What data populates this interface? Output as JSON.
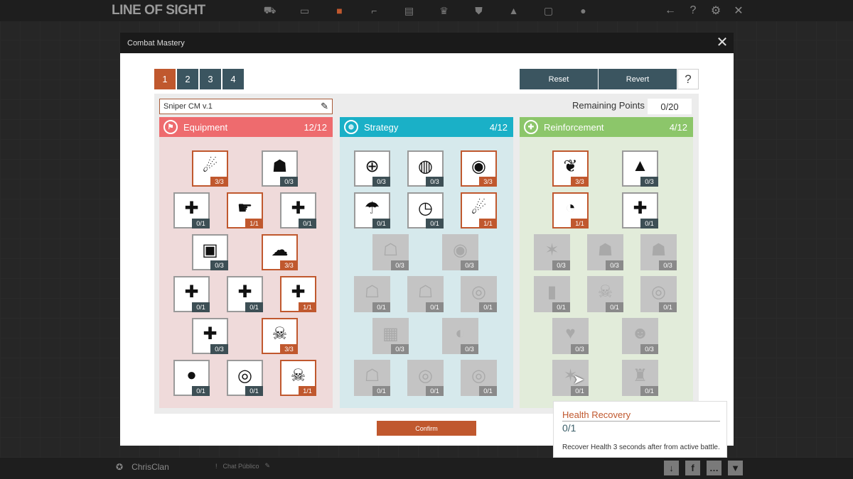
{
  "app": {
    "logo": "LINE OF SIGHT"
  },
  "topnav": [
    "cart-icon",
    "inventory-icon",
    "mastery-icon",
    "weapon-icon",
    "gear-icon",
    "trophy-icon",
    "clan-icon",
    "camp-icon",
    "box-icon",
    "hint-icon"
  ],
  "top_right": [
    "back-icon",
    "help-icon",
    "settings-icon",
    "close-icon"
  ],
  "bottom": {
    "clan_name": "ChrisClan",
    "chat_label": "Chat Público"
  },
  "modal": {
    "title": "Combat Mastery",
    "pages": [
      "1",
      "2",
      "3",
      "4"
    ],
    "active_page": "1",
    "reset_label": "Reset",
    "revert_label": "Revert",
    "help_label": "?",
    "preset_name": "Sniper CM v.1",
    "remaining_label": "Remaining Points",
    "remaining_value": "0/20",
    "confirm_label": "Confirm",
    "colors": {
      "accent": "#c0582e",
      "button": "#3b5560",
      "equipment": "#e8646a",
      "strategy": "#1ab0c7",
      "reinforcement": "#8cc66a"
    }
  },
  "columns": [
    {
      "id": "equipment",
      "name": "Equipment",
      "count": "12/12",
      "head_color": "#ee6b6e",
      "body_color": "#efdada",
      "tiles": [
        {
          "icon": "sniper-aim-icon",
          "glyph": "☄",
          "value": "3/3",
          "state": "active"
        },
        {
          "icon": "helmet-icon",
          "glyph": "☗",
          "value": "0/3",
          "state": "normal"
        },
        {
          "icon": "medkit-cross-icon",
          "glyph": "✚",
          "value": "0/1",
          "state": "normal"
        },
        {
          "icon": "hand-grenade-icon",
          "glyph": "☛",
          "value": "1/1",
          "state": "active"
        },
        {
          "icon": "plus-ammo-icon",
          "glyph": "✚",
          "value": "0/1",
          "state": "normal"
        },
        {
          "icon": "armor-vest-icon",
          "glyph": "▣",
          "value": "0/3",
          "state": "normal"
        },
        {
          "icon": "explosion-icon",
          "glyph": "☁",
          "value": "3/3",
          "state": "active"
        },
        {
          "icon": "plus-magazine-icon",
          "glyph": "✚",
          "value": "0/1",
          "state": "normal"
        },
        {
          "icon": "plus-grenade-icon",
          "glyph": "✚",
          "value": "0/1",
          "state": "normal"
        },
        {
          "icon": "plus-smoke-icon",
          "glyph": "✚",
          "value": "1/1",
          "state": "active"
        },
        {
          "icon": "plus-bullet-icon",
          "glyph": "✚",
          "value": "0/3",
          "state": "normal"
        },
        {
          "icon": "skull-blast-icon",
          "glyph": "☠",
          "value": "3/3",
          "state": "active"
        },
        {
          "icon": "grenade-icon",
          "glyph": "●",
          "value": "0/1",
          "state": "normal"
        },
        {
          "icon": "bullet-rings-icon",
          "glyph": "◎",
          "value": "0/1",
          "state": "normal"
        },
        {
          "icon": "skull-target-icon",
          "glyph": "☠",
          "value": "1/1",
          "state": "active"
        }
      ]
    },
    {
      "id": "strategy",
      "name": "Strategy",
      "count": "4/12",
      "head_color": "#1ab0c7",
      "body_color": "#d6e9ec",
      "tiles": [
        {
          "icon": "crosshair-soldier-icon",
          "glyph": "⊕",
          "value": "0/3",
          "state": "normal"
        },
        {
          "icon": "radar-sweep-icon",
          "glyph": "◍",
          "value": "0/3",
          "state": "normal"
        },
        {
          "icon": "radar-icon",
          "glyph": "◉",
          "value": "3/3",
          "state": "active"
        },
        {
          "icon": "parachute-icon",
          "glyph": "☂",
          "value": "0/1",
          "state": "normal"
        },
        {
          "icon": "timer-bomb-icon",
          "glyph": "◷",
          "value": "0/1",
          "state": "normal"
        },
        {
          "icon": "runner-icon",
          "glyph": "☄",
          "value": "1/1",
          "state": "active"
        },
        {
          "icon": "crawling-soldier-icon",
          "glyph": "☖",
          "value": "0/3",
          "state": "locked"
        },
        {
          "icon": "eye-scan-icon",
          "glyph": "◉",
          "value": "0/3",
          "state": "locked"
        },
        {
          "icon": "sprint-icon",
          "glyph": "☖",
          "value": "0/1",
          "state": "locked"
        },
        {
          "icon": "dash-icon",
          "glyph": "☖",
          "value": "0/1",
          "state": "locked"
        },
        {
          "icon": "landmine-icon",
          "glyph": "◎",
          "value": "0/1",
          "state": "locked"
        },
        {
          "icon": "timed-device-icon",
          "glyph": "▦",
          "value": "0/3",
          "state": "locked"
        },
        {
          "icon": "horn-icon",
          "glyph": "◐",
          "value": "0/3",
          "state": "locked"
        },
        {
          "icon": "tripwire-icon",
          "glyph": "☖",
          "value": "0/1",
          "state": "locked"
        },
        {
          "icon": "signal-icon",
          "glyph": "◎",
          "value": "0/1",
          "state": "locked"
        },
        {
          "icon": "alert-rings-icon",
          "glyph": "◎",
          "value": "0/1",
          "state": "locked"
        }
      ]
    },
    {
      "id": "reinforcement",
      "name": "Reinforcement",
      "count": "4/12",
      "head_color": "#8cc66a",
      "body_color": "#e2ecda",
      "tiles": [
        {
          "icon": "wings-icon",
          "glyph": "❦",
          "value": "3/3",
          "state": "active"
        },
        {
          "icon": "rank-chevrons-icon",
          "glyph": "▲",
          "value": "0/3",
          "state": "normal"
        },
        {
          "icon": "ear-sound-icon",
          "glyph": "◔",
          "value": "1/1",
          "state": "active"
        },
        {
          "icon": "medical-cross-icon",
          "glyph": "✚",
          "value": "0/1",
          "state": "normal"
        },
        {
          "icon": "impact-icon",
          "glyph": "✶",
          "value": "0/3",
          "state": "locked"
        },
        {
          "icon": "badge-icon",
          "glyph": "☗",
          "value": "0/3",
          "state": "locked"
        },
        {
          "icon": "shield-bolt-icon",
          "glyph": "☗",
          "value": "0/3",
          "state": "locked"
        },
        {
          "icon": "battery-icon",
          "glyph": "▮",
          "value": "0/1",
          "state": "locked"
        },
        {
          "icon": "skull-shield-icon",
          "glyph": "☠",
          "value": "0/1",
          "state": "locked"
        },
        {
          "icon": "droplet-target-icon",
          "glyph": "◎",
          "value": "0/1",
          "state": "locked"
        },
        {
          "icon": "heart-plus-icon",
          "glyph": "♥",
          "value": "0/3",
          "state": "locked"
        },
        {
          "icon": "gas-mask-icon",
          "glyph": "☻",
          "value": "0/3",
          "state": "locked"
        },
        {
          "icon": "health-recovery-icon",
          "glyph": "✶",
          "value": "0/1",
          "state": "locked"
        },
        {
          "icon": "turret-icon",
          "glyph": "♜",
          "value": "0/1",
          "state": "locked"
        }
      ]
    }
  ],
  "tooltip": {
    "title": "Health Recovery",
    "value": "0/1",
    "description": "Recover Health 3 seconds after from active battle."
  }
}
